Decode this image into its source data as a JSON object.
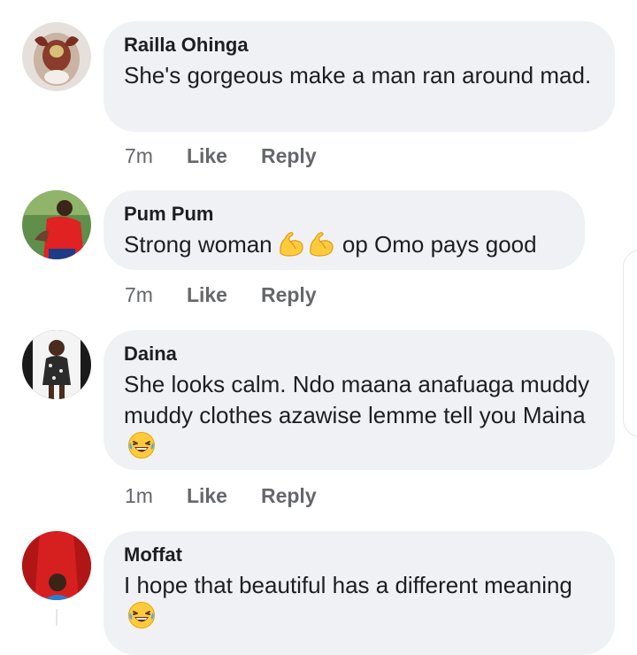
{
  "comments": [
    {
      "author": "Railla Ohinga",
      "text": "She's gorgeous make a man ran around mad.",
      "time": "7m",
      "like_label": "Like",
      "reply_label": "Reply",
      "avatar_icon": "avatar-photo"
    },
    {
      "author": "Pum Pum",
      "text_before_emoji": "Strong woman",
      "emoji": "flexed-biceps-icon",
      "text_after_emoji": "op  Omo pays good",
      "time": "7m",
      "like_label": "Like",
      "reply_label": "Reply",
      "avatar_icon": "avatar-photo"
    },
    {
      "author": "Daina",
      "text": "She looks calm.  Ndo maana anafuaga muddy muddy clothes  azawise lemme tell you Maina",
      "emoji": "tears-of-joy-icon",
      "time": "1m",
      "like_label": "Like",
      "reply_label": "Reply",
      "avatar_icon": "avatar-photo"
    },
    {
      "author": "Moffat",
      "text": "I hope that beautiful has a different meaning",
      "emoji": "tears-of-joy-icon",
      "avatar_icon": "avatar-photo"
    }
  ],
  "colors": {
    "bubble": "#eff1f4",
    "author_text": "#1c1e21",
    "action_text": "#65676b",
    "emoji_yellow": "#ffcb3d"
  }
}
